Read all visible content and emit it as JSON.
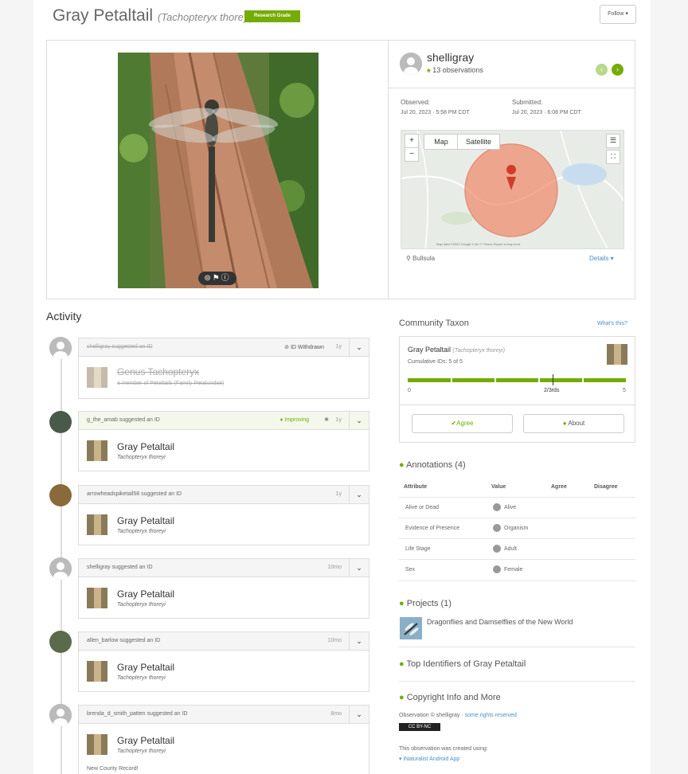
{
  "header": {
    "common_name": "Gray Petaltail",
    "scientific_name": "(Tachopteryx thoreyi)",
    "quality_badge": "Research Grade",
    "follow_label": "Follow ▾"
  },
  "observer": {
    "username": "shelligray",
    "observations": "13 observations"
  },
  "photo": {
    "controls": "⊜⚑ⓘ"
  },
  "dates": {
    "observed_label": "Observed:",
    "observed_value": "Jul 20, 2023 · 5:58 PM CDT",
    "submitted_label": "Submitted:",
    "submitted_value": "Jul 20, 2023 · 6:08 PM CDT"
  },
  "map": {
    "zoom_in": "+",
    "zoom_out": "−",
    "map_tab": "Map",
    "satellite_tab": "Satellite",
    "attribution": "Map data ©2024 Google   1 km ⎯⎯   Terms   Report a map error",
    "place": "Bullsula",
    "details_link": "Details ▾"
  },
  "activity": {
    "heading": "Activity",
    "items": [
      {
        "who": "shelligray suggested an ID",
        "status": "ID Withdrawn",
        "time": "1y",
        "taxon": "Genus Tachopteryx",
        "sub": "a member of Petaltails (Family Petaluridae)"
      },
      {
        "who": "g_the_amab suggested an ID",
        "status": "Improving",
        "time": "1y",
        "taxon": "Gray Petaltail",
        "sub": "Tachopteryx thoreyi"
      },
      {
        "who": "arrowheadspiketail58 suggested an ID",
        "time": "1y",
        "taxon": "Gray Petaltail",
        "sub": "Tachopteryx thoreyi"
      },
      {
        "who": "shelligray suggested an ID",
        "time": "10mo",
        "taxon": "Gray Petaltail",
        "sub": "Tachopteryx thoreyi"
      },
      {
        "who": "allen_barlow suggested an ID",
        "time": "10mo",
        "taxon": "Gray Petaltail",
        "sub": "Tachopteryx thoreyi"
      },
      {
        "who": "brenda_d_smith_patten suggested an ID",
        "time": "8mo",
        "taxon": "Gray Petaltail",
        "sub": "Tachopteryx thoreyi",
        "note": "New County Record!"
      }
    ]
  },
  "community": {
    "heading": "Community Taxon",
    "whats_this": "What's this?",
    "taxon": "Gray Petaltail",
    "taxon_sci": "(Tachopteryx thoreyi)",
    "cumulative": "Cumulative IDs: 5 of 5",
    "scale_min": "0",
    "scale_mid": "2/3rds",
    "scale_max": "5",
    "agree": "✔Agree",
    "about": "About",
    "agreement_fraction": 1.0
  },
  "annotations": {
    "heading": "Annotations (4)",
    "columns": [
      "Attribute",
      "Value",
      "Agree",
      "Disagree"
    ],
    "rows": [
      {
        "attr": "Alive or Dead",
        "value": "Alive"
      },
      {
        "attr": "Evidence of Presence",
        "value": "Organism"
      },
      {
        "attr": "Life Stage",
        "value": "Adult"
      },
      {
        "attr": "Sex",
        "value": "Female"
      }
    ]
  },
  "projects": {
    "heading": "Projects (1)",
    "item": "Dragonflies and Damselflies of the New World"
  },
  "top_identifiers": "Top Identifiers of Gray Petaltail",
  "copyright": {
    "heading": "Copyright Info and More",
    "line_prefix": "Observation © shelligray ·",
    "line_link": "some rights reserved",
    "cc_badge": "CC BY-NC",
    "created_using": "This observation was created using:",
    "app": "iNaturalist Android App"
  },
  "colors": {
    "accent": "#74ac00",
    "link": "#4a90c8",
    "accuracy_circle": "#f08060"
  }
}
